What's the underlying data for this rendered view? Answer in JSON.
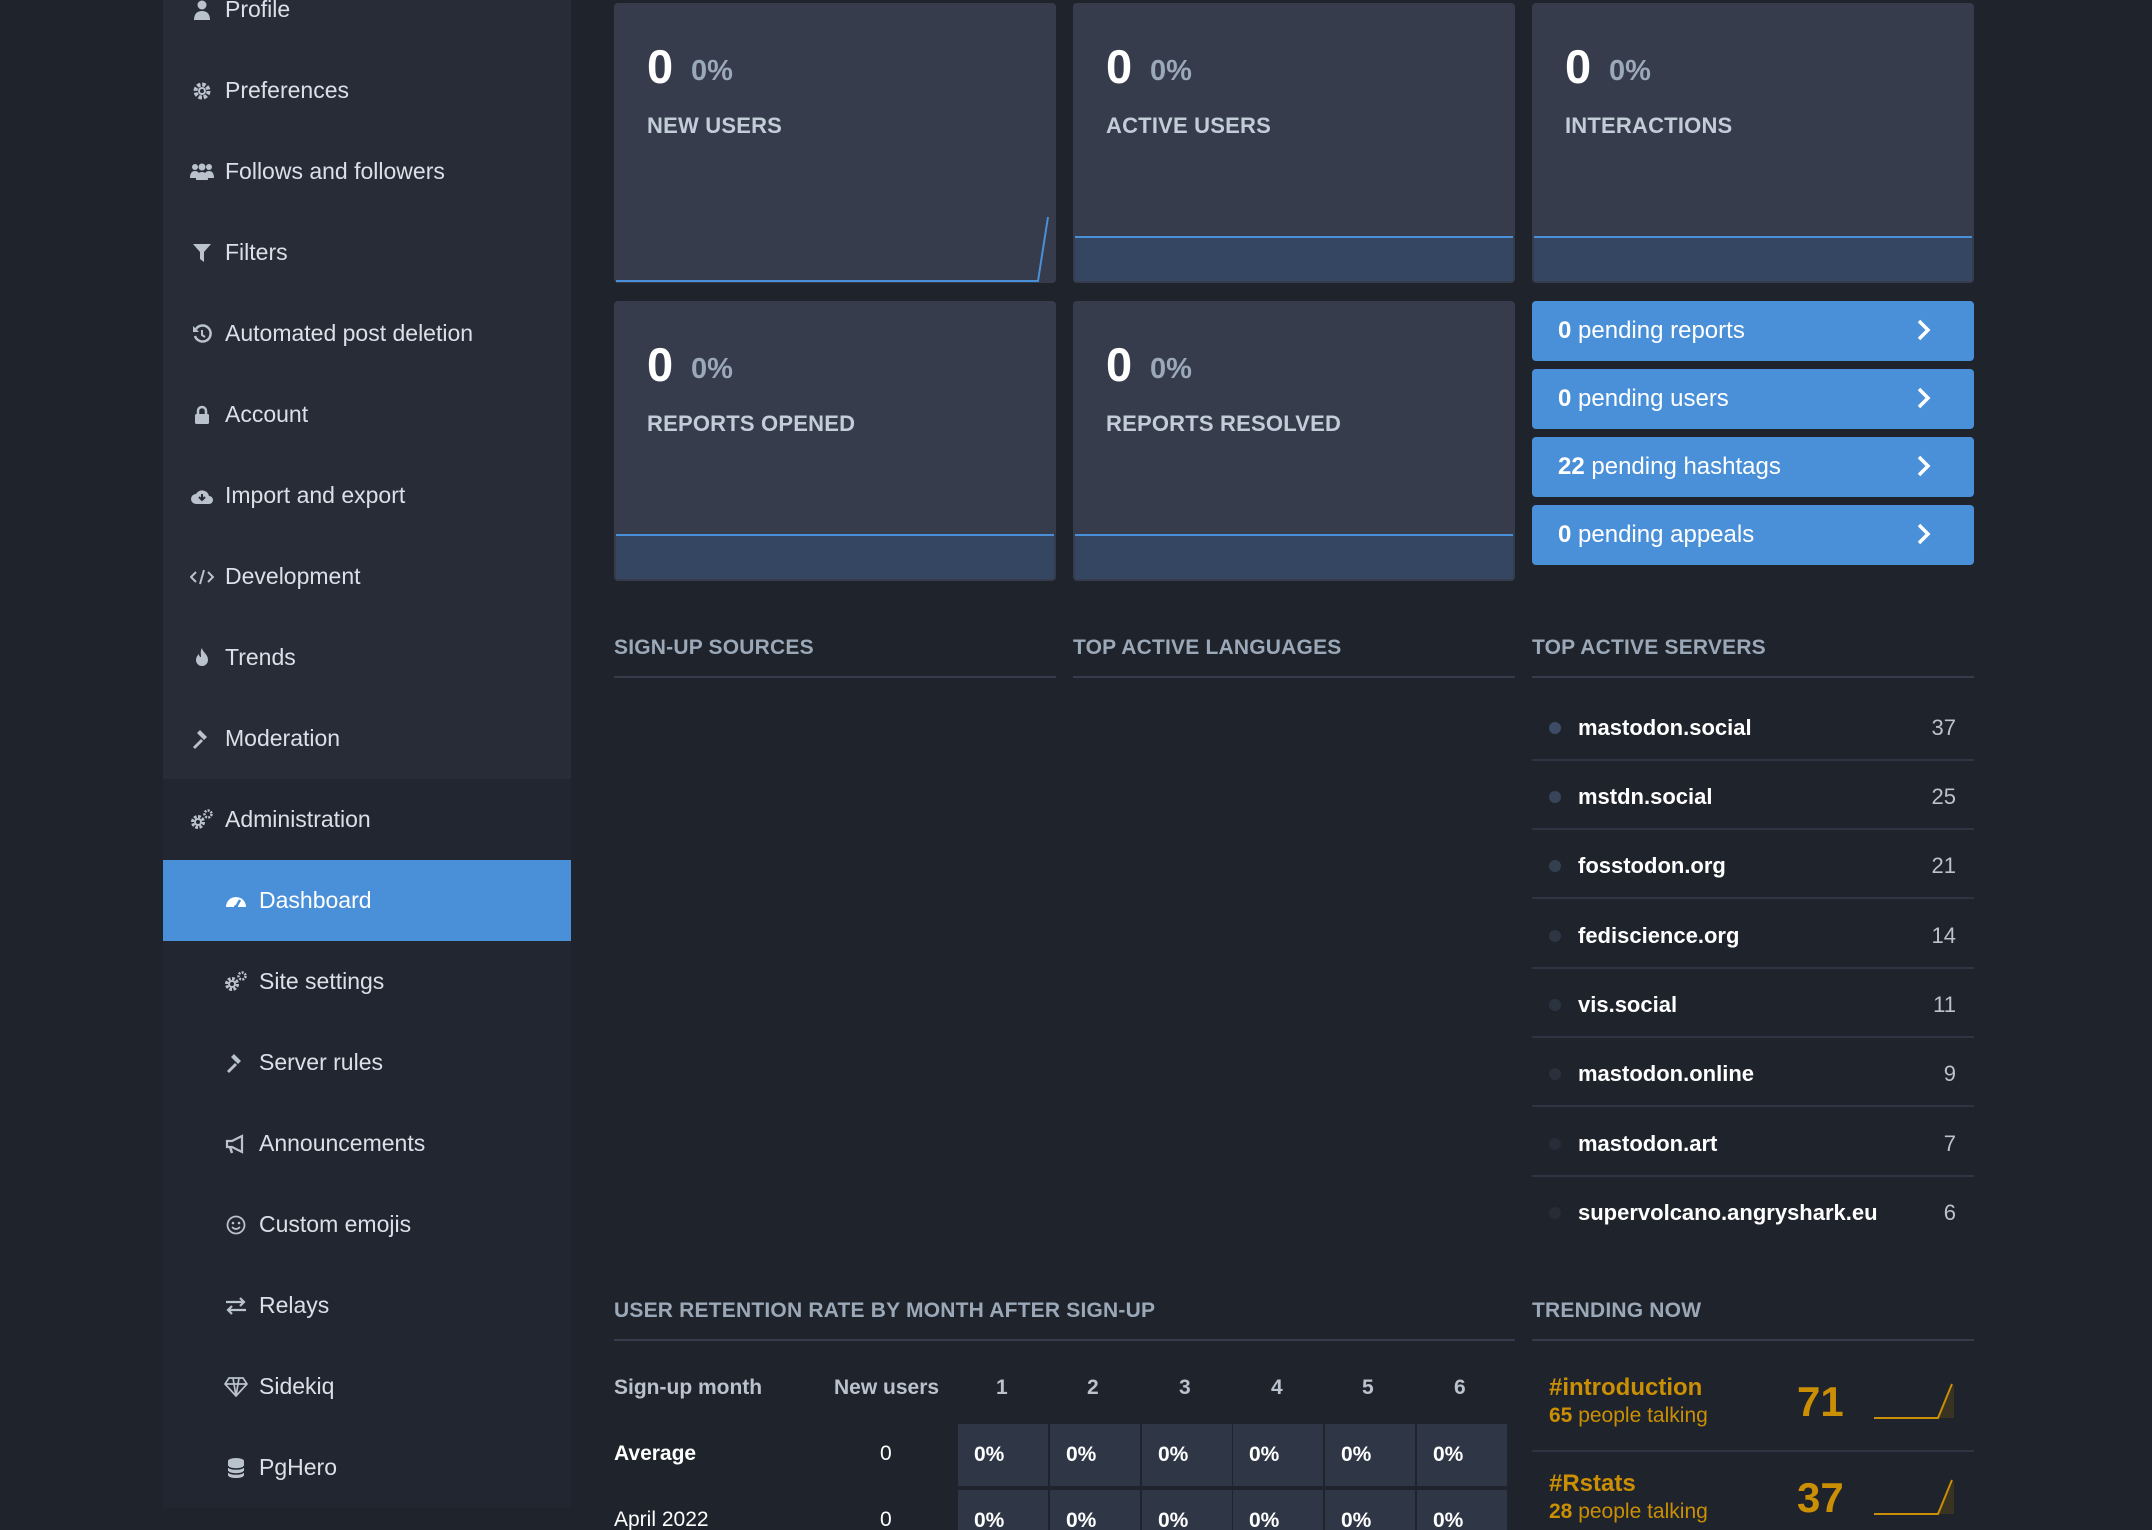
{
  "sidebar": {
    "items": [
      {
        "label": "Profile",
        "icon": "user-icon"
      },
      {
        "label": "Preferences",
        "icon": "gear-icon"
      },
      {
        "label": "Follows and followers",
        "icon": "users-icon"
      },
      {
        "label": "Filters",
        "icon": "filter-icon"
      },
      {
        "label": "Automated post deletion",
        "icon": "history-icon"
      },
      {
        "label": "Account",
        "icon": "lock-icon"
      },
      {
        "label": "Import and export",
        "icon": "cloud-download-icon"
      },
      {
        "label": "Development",
        "icon": "code-icon"
      },
      {
        "label": "Trends",
        "icon": "fire-icon"
      },
      {
        "label": "Moderation",
        "icon": "gavel-icon"
      },
      {
        "label": "Administration",
        "icon": "cogs-icon"
      }
    ],
    "sub_items": [
      {
        "label": "Dashboard",
        "icon": "tachometer-icon",
        "active": true
      },
      {
        "label": "Site settings",
        "icon": "cogs-icon"
      },
      {
        "label": "Server rules",
        "icon": "gavel-icon"
      },
      {
        "label": "Announcements",
        "icon": "bullhorn-icon"
      },
      {
        "label": "Custom emojis",
        "icon": "smile-icon"
      },
      {
        "label": "Relays",
        "icon": "exchange-icon"
      },
      {
        "label": "Sidekiq",
        "icon": "diamond-icon"
      },
      {
        "label": "PgHero",
        "icon": "database-icon"
      }
    ]
  },
  "metrics": [
    {
      "value": "0",
      "change": "0%",
      "title": "NEW USERS"
    },
    {
      "value": "0",
      "change": "0%",
      "title": "ACTIVE USERS"
    },
    {
      "value": "0",
      "change": "0%",
      "title": "INTERACTIONS"
    },
    {
      "value": "0",
      "change": "0%",
      "title": "REPORTS OPENED"
    },
    {
      "value": "0",
      "change": "0%",
      "title": "REPORTS RESOLVED"
    }
  ],
  "pending": [
    {
      "count": "0",
      "text": "pending reports"
    },
    {
      "count": "0",
      "text": "pending users"
    },
    {
      "count": "22",
      "text": "pending hashtags"
    },
    {
      "count": "0",
      "text": "pending appeals"
    }
  ],
  "sections": {
    "signup_sources": "SIGN-UP SOURCES",
    "top_languages": "TOP ACTIVE LANGUAGES",
    "top_servers": "TOP ACTIVE SERVERS",
    "retention": "USER RETENTION RATE BY MONTH AFTER SIGN-UP",
    "trending": "TRENDING NOW"
  },
  "servers": [
    {
      "name": "mastodon.social",
      "count": "37"
    },
    {
      "name": "mstdn.social",
      "count": "25"
    },
    {
      "name": "fosstodon.org",
      "count": "21"
    },
    {
      "name": "fediscience.org",
      "count": "14"
    },
    {
      "name": "vis.social",
      "count": "11"
    },
    {
      "name": "mastodon.online",
      "count": "9"
    },
    {
      "name": "mastodon.art",
      "count": "7"
    },
    {
      "name": "supervolcano.angryshark.eu",
      "count": "6"
    }
  ],
  "retention": {
    "headers": [
      "Sign-up month",
      "New users",
      "1",
      "2",
      "3",
      "4",
      "5",
      "6"
    ],
    "rows": [
      {
        "month": "Average",
        "new_users": "0",
        "cells": [
          "0%",
          "0%",
          "0%",
          "0%",
          "0%",
          "0%"
        ]
      },
      {
        "month": "April 2022",
        "new_users": "0",
        "cells": [
          "0%",
          "0%",
          "0%",
          "0%",
          "0%",
          "0%"
        ]
      }
    ]
  },
  "trending": [
    {
      "tag": "#introduction",
      "people": "65",
      "people_label": "people talking",
      "count": "71"
    },
    {
      "tag": "#Rstats",
      "people": "28",
      "people_label": "people talking",
      "count": "37"
    }
  ],
  "colors": {
    "accent": "#4a90d9",
    "trending": "#ca8f04",
    "card": "#363c4c"
  }
}
